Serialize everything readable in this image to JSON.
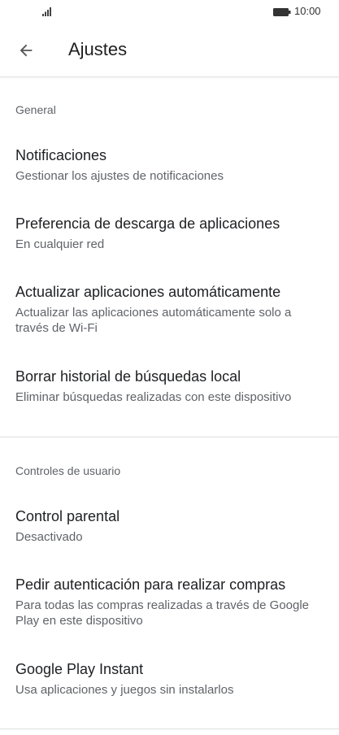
{
  "status_bar": {
    "time": "10:00"
  },
  "header": {
    "title": "Ajustes"
  },
  "sections": {
    "general": {
      "header": "General",
      "items": [
        {
          "title": "Notificaciones",
          "subtitle": "Gestionar los ajustes de notificaciones"
        },
        {
          "title": "Preferencia de descarga de aplicaciones",
          "subtitle": "En cualquier red"
        },
        {
          "title": "Actualizar aplicaciones automáticamente",
          "subtitle": "Actualizar las aplicaciones automáticamente solo a través de Wi-Fi"
        },
        {
          "title": "Borrar historial de búsquedas local",
          "subtitle": "Eliminar búsquedas realizadas con este dispositivo"
        }
      ]
    },
    "user_controls": {
      "header": "Controles de usuario",
      "items": [
        {
          "title": "Control parental",
          "subtitle": "Desactivado"
        },
        {
          "title": "Pedir autenticación para realizar compras",
          "subtitle": "Para todas las compras realizadas a través de Google Play en este dispositivo"
        },
        {
          "title": "Google Play Instant",
          "subtitle": "Usa aplicaciones y juegos sin instalarlos"
        }
      ]
    }
  }
}
